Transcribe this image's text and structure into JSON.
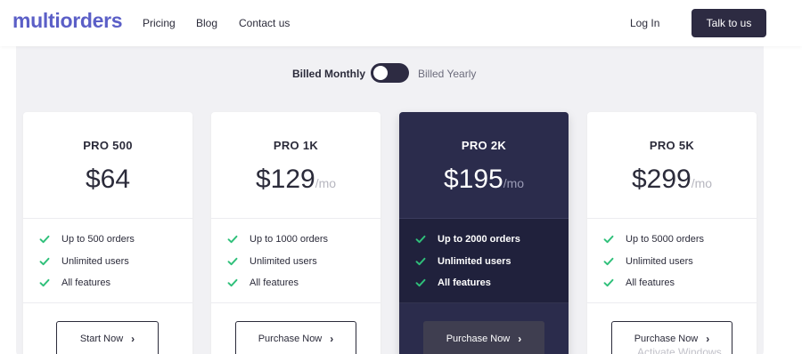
{
  "brand": {
    "logo": "multiorders",
    "color": "#5b5fc7"
  },
  "nav": {
    "links": [
      "Pricing",
      "Blog",
      "Contact us"
    ],
    "login": "Log In",
    "cta": "Talk to us"
  },
  "billing": {
    "monthly": "Billed Monthly",
    "yearly": "Billed Yearly",
    "selected": "monthly"
  },
  "plans": [
    {
      "name": "PRO 500",
      "price": "$64",
      "per": "",
      "features": [
        "Up to 500 orders",
        "Unlimited users",
        "All features"
      ],
      "button": "Start Now",
      "highlighted": false
    },
    {
      "name": "PRO 1K",
      "price": "$129",
      "per": "/mo",
      "features": [
        "Up to 1000 orders",
        "Unlimited users",
        "All features"
      ],
      "button": "Purchase Now",
      "highlighted": false
    },
    {
      "name": "PRO 2K",
      "price": "$195",
      "per": "/mo",
      "features": [
        "Up to 2000 orders",
        "Unlimited users",
        "All features"
      ],
      "button": "Purchase Now",
      "highlighted": true
    },
    {
      "name": "PRO 5K",
      "price": "$299",
      "per": "/mo",
      "features": [
        "Up to 5000 orders",
        "Unlimited users",
        "All features"
      ],
      "button": "Purchase Now",
      "highlighted": false
    }
  ],
  "watermark": "Activate Windows",
  "colors": {
    "check": "#2fc07a",
    "dark_card": "#2b2c4c",
    "button_dark": "#2d2b42"
  }
}
